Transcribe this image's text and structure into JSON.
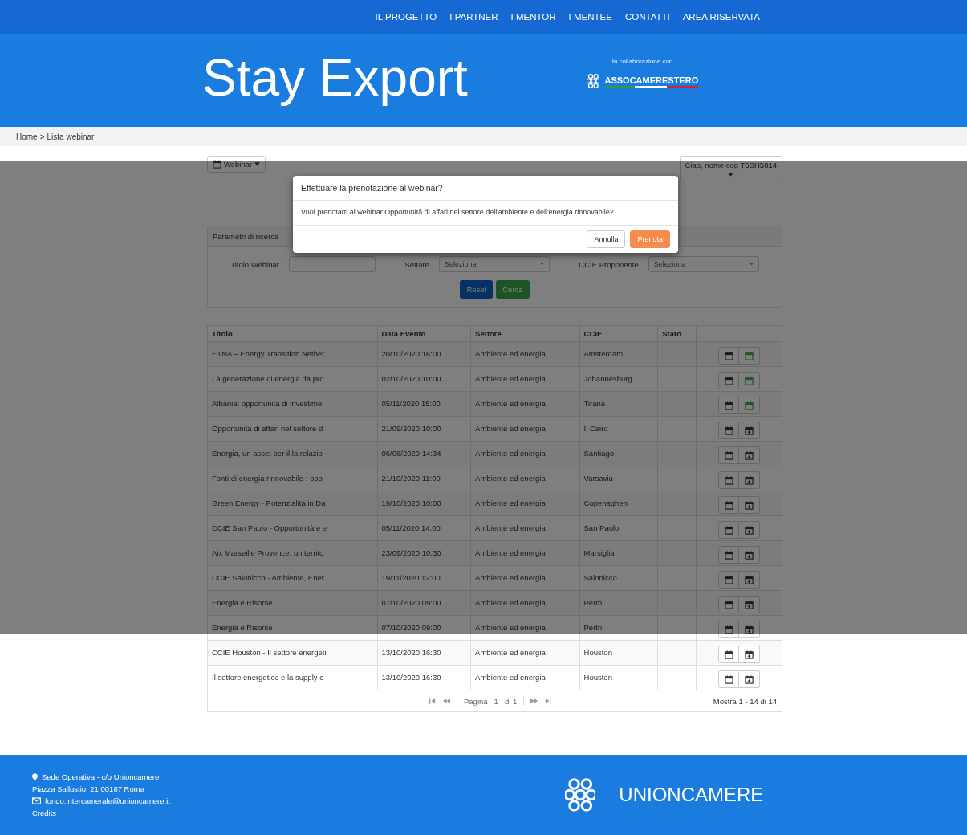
{
  "nav": [
    "IL PROGETTO",
    "I PARTNER",
    "I MENTOR",
    "I MENTEE",
    "CONTATTI",
    "AREA RISERVATA"
  ],
  "header": {
    "title": "Stay Export",
    "partner_caption": "In collaborazione con",
    "partner_name": "ASSOCAMERESTERO"
  },
  "breadcrumb": {
    "items": [
      "Home",
      "Lista webinar"
    ],
    "separator": ">"
  },
  "toolbar": {
    "menu_button": "Webinar",
    "user_button": "Ciao, nome cog T6SH5814"
  },
  "search_panel": {
    "title": "Parametri di ricerca",
    "fields": [
      {
        "label": "Titolo Webinar",
        "kind": "text"
      },
      {
        "label": "Settore",
        "kind": "select",
        "value": "Seleziona"
      },
      {
        "label": "CCIE Proponente",
        "kind": "select",
        "value": "Seleziona"
      }
    ],
    "buttons": [
      {
        "label": "Reset",
        "kind": "primary"
      },
      {
        "label": "Cerca",
        "kind": "success"
      }
    ]
  },
  "table": {
    "columns": [
      "Titolo",
      "Data Evento",
      "Settore",
      "CCIE",
      "Stato"
    ],
    "rows": [
      {
        "title": "ETNA – Energy Transition Nether",
        "date": "20/10/2020 16:00",
        "sector": "Ambiente ed energia",
        "ccie": "Amsterdam",
        "booked": true
      },
      {
        "title": "La generazione di energia da pro",
        "date": "02/10/2020 10:00",
        "sector": "Ambiente ed energia",
        "ccie": "Johannesburg",
        "booked": true
      },
      {
        "title": "Albania: opportunità di investime",
        "date": "05/11/2020 15:00",
        "sector": "Ambiente ed energia",
        "ccie": "Tirana",
        "booked": true
      },
      {
        "title": "Opportunità di affari nel settore d",
        "date": "21/09/2020 10:00",
        "sector": "Ambiente ed energia",
        "ccie": "Il Cairo",
        "booked": false
      },
      {
        "title": "Energia, un asset per il la relazio",
        "date": "06/08/2020 14:34",
        "sector": "Ambiente ed energia",
        "ccie": "Santiago",
        "booked": false
      },
      {
        "title": "Fonti di energia rinnovabile :  opp",
        "date": "21/10/2020 11:00",
        "sector": "Ambiente ed energia",
        "ccie": "Varsavia",
        "booked": false
      },
      {
        "title": "Green Energy - Potenzialità in Da",
        "date": "19/10/2020 10:00",
        "sector": "Ambiente ed energia",
        "ccie": "Copenaghen",
        "booked": false
      },
      {
        "title": "CCIE San Paolo - Opportunità e e",
        "date": "05/11/2020 14:00",
        "sector": "Ambiente ed energia",
        "ccie": "San Paolo",
        "booked": false
      },
      {
        "title": "Aix Marseille Provence: un territo",
        "date": "23/09/2020 10:30",
        "sector": "Ambiente ed energia",
        "ccie": "Marsiglia",
        "booked": false
      },
      {
        "title": "CCIE Salonicco - Ambiente, Ener",
        "date": "19/11/2020 12:00",
        "sector": "Ambiente ed energia",
        "ccie": "Salonicco",
        "booked": false
      },
      {
        "title": "Energia e Risorse",
        "date": "07/10/2020 09:00",
        "sector": "Ambiente ed energia",
        "ccie": "Perth",
        "booked": false
      },
      {
        "title": "Energia e Risorse",
        "date": "07/10/2020 09:00",
        "sector": "Ambiente ed energia",
        "ccie": "Perth",
        "booked": false
      },
      {
        "title": "CCIE Houston - Il settore energeti",
        "date": "13/10/2020 16:30",
        "sector": "Ambiente ed energia",
        "ccie": "Houston",
        "booked": false
      },
      {
        "title": "Il settore energetico e la supply c",
        "date": "13/10/2020 16:30",
        "sector": "Ambiente ed energia",
        "ccie": "Houston",
        "booked": false
      }
    ],
    "pagination": {
      "page_label": "Pagina",
      "page": "1",
      "of": "di 1",
      "summary": "Mostra 1 - 14 di 14"
    }
  },
  "modal": {
    "title": "Effettuare la prenotazione al webinar?",
    "message": "Vuoi prenotarti al webinar Opportunità di affari nel settore dell'ambiente e dell'energia rinnovabile?",
    "buttons": [
      {
        "label": "Annulla",
        "kind": "default"
      },
      {
        "label": "Prenota",
        "kind": "primary"
      }
    ]
  },
  "footer": {
    "address": [
      "Sede Operativa - c/o Unioncamere",
      "Piazza Sallustio, 21 00187 Roma"
    ],
    "email": "fondo.intercamerale@unioncamere.it",
    "credits": "Credits",
    "brand": "UNIONCAMERE"
  }
}
